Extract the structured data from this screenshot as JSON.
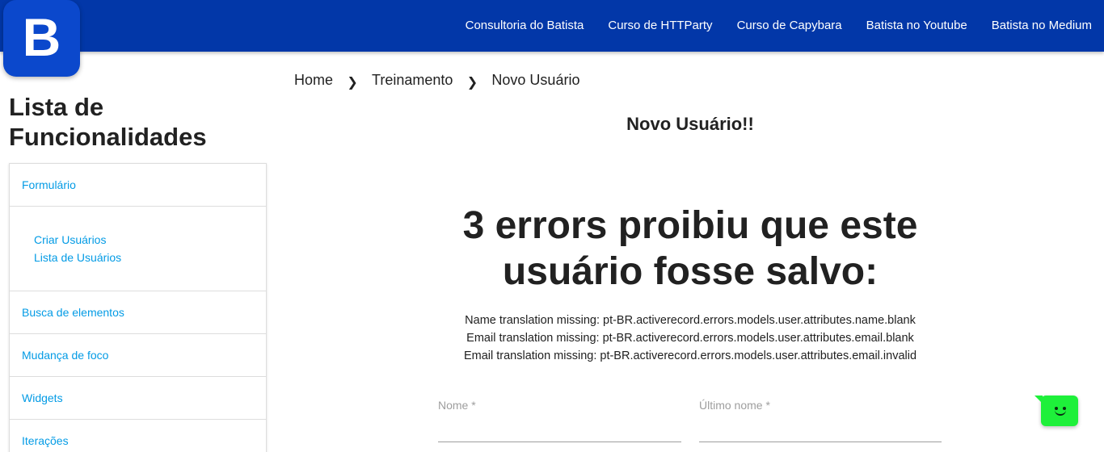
{
  "header": {
    "logo_letter": "B",
    "brand_color": "#0237a8",
    "nav": [
      {
        "label": "Consultoria do Batista"
      },
      {
        "label": "Curso de HTTParty"
      },
      {
        "label": "Curso de Capybara"
      },
      {
        "label": "Batista no Youtube"
      },
      {
        "label": "Batista no Medium"
      }
    ]
  },
  "sidebar": {
    "title": "Lista de Funcionalidades",
    "link_color": "#039be5",
    "items": [
      {
        "label": "Formulário"
      },
      {
        "label": "Criar Usuários"
      },
      {
        "label": "Lista de Usuários"
      },
      {
        "label": "Busca de elementos"
      },
      {
        "label": "Mudança de foco"
      },
      {
        "label": "Widgets"
      },
      {
        "label": "Iterações"
      }
    ]
  },
  "breadcrumb": {
    "items": [
      "Home",
      "Treinamento",
      "Novo Usuário"
    ],
    "separator": "❯"
  },
  "main": {
    "heading": "Novo Usuário!!",
    "error_title": "3 errors proibiu que este usuário fosse salvo:",
    "errors": [
      "Name translation missing: pt-BR.activerecord.errors.models.user.attributes.name.blank",
      "Email translation missing: pt-BR.activerecord.errors.models.user.attributes.email.blank",
      "Email translation missing: pt-BR.activerecord.errors.models.user.attributes.email.invalid"
    ],
    "form": {
      "nome_label": "Nome *",
      "nome_value": "",
      "ultimo_nome_label": "Último nome *",
      "ultimo_nome_value": ""
    }
  },
  "chat_widget": {
    "icon": "smiley-chat-icon",
    "color": "#1ef03a"
  }
}
